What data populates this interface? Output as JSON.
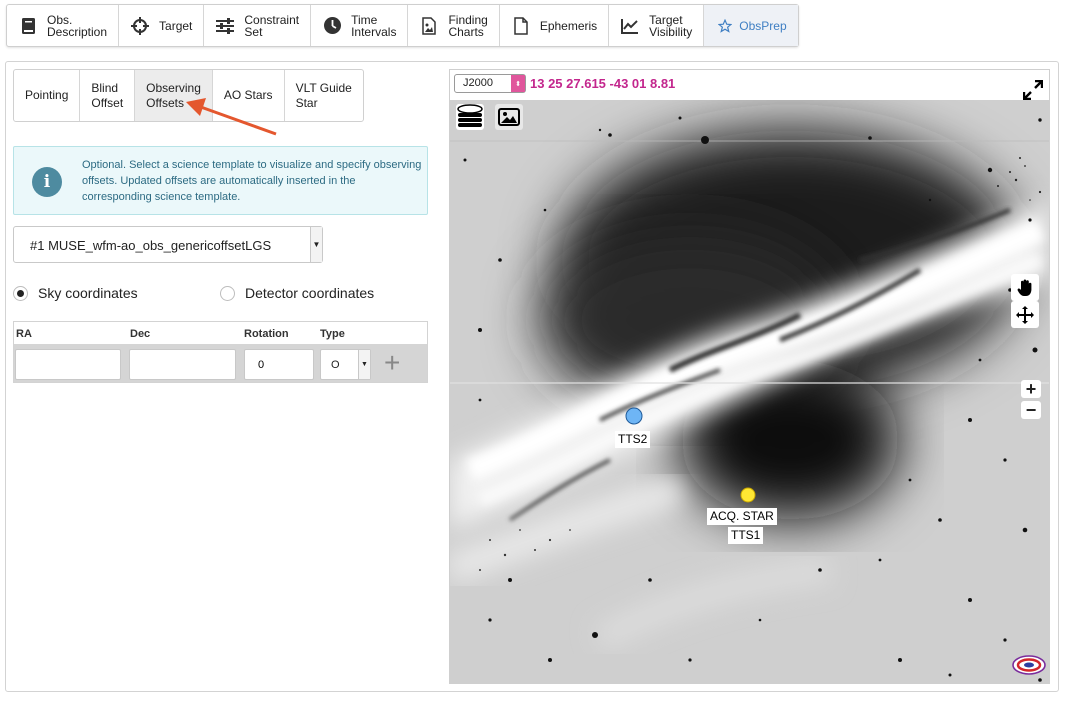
{
  "topbar": {
    "tabs": [
      {
        "label": "Obs.\nDescription",
        "icon": "book-icon"
      },
      {
        "label": "Target",
        "icon": "crosshair-icon"
      },
      {
        "label": "Constraint\nSet",
        "icon": "sliders-icon"
      },
      {
        "label": "Time\nIntervals",
        "icon": "clock-icon"
      },
      {
        "label": "Finding\nCharts",
        "icon": "image-file-icon"
      },
      {
        "label": "Ephemeris",
        "icon": "file-icon"
      },
      {
        "label": "Target\nVisibility",
        "icon": "line-chart-icon"
      },
      {
        "label": "ObsPrep",
        "icon": "star-icon"
      }
    ],
    "active_color": "#3f7fc3"
  },
  "subtabs": [
    {
      "label": "Pointing"
    },
    {
      "label": "Blind\nOffset"
    },
    {
      "label": "Observing\nOffsets"
    },
    {
      "label": "AO Stars"
    },
    {
      "label": "VLT Guide\nStar"
    }
  ],
  "info": {
    "text": "Optional. Select a science template to visualize and specify observing offsets. Updated offsets are automatically inserted in the corresponding science template.",
    "icon": "info-icon"
  },
  "template_select": {
    "value": "#1 MUSE_wfm-ao_obs_genericoffsetLGS"
  },
  "coords_mode": {
    "sky_label": "Sky coordinates",
    "detector_label": "Detector coordinates",
    "selected": "sky"
  },
  "offsets_table": {
    "headers": {
      "ra": "RA",
      "dec": "Dec",
      "rotation": "Rotation",
      "type": "Type"
    },
    "row": {
      "ra": "",
      "dec": "",
      "rotation": "0",
      "type": "O"
    },
    "add_label": "+"
  },
  "viewer": {
    "coord_system": "J2000",
    "coords": "13 25 27.615 -43 01 8.81",
    "coords_color": "#c3268d",
    "markers": [
      {
        "label": "TTS2",
        "color": "#6eb5f5"
      },
      {
        "label": "ACQ. STAR",
        "color": "#ffe733"
      },
      {
        "label": "TTS1",
        "color": "#ffe733"
      }
    ],
    "zoom_in": "+",
    "zoom_out": "−"
  }
}
